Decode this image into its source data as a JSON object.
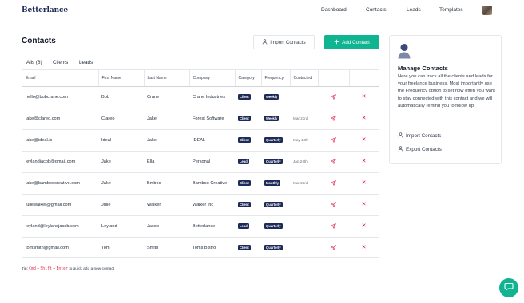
{
  "brand": "Betterlance",
  "nav": {
    "items": [
      {
        "label": "Dashboard"
      },
      {
        "label": "Contacts"
      },
      {
        "label": "Leads"
      },
      {
        "label": "Templates"
      }
    ]
  },
  "page": {
    "title": "Contacts",
    "import_label": "Import Contacts",
    "add_label": "Add Contact"
  },
  "tabs": [
    {
      "label": "Alls (8)",
      "active": true
    },
    {
      "label": "Clients"
    },
    {
      "label": "Leads"
    }
  ],
  "table": {
    "columns": [
      "Email",
      "First Name",
      "Last Name",
      "Company",
      "Category",
      "Frequency",
      "Contacted"
    ],
    "rows": [
      {
        "email": "hello@bobcrane.com",
        "first": "Bob",
        "last": "Crane",
        "company": "Crane Industries",
        "category": "Client",
        "frequency": "Weekly",
        "contacted": ""
      },
      {
        "email": "jake@clareo.com",
        "first": "Clareo",
        "last": "Jake",
        "company": "Forest Software",
        "category": "Client",
        "frequency": "Weekly",
        "contacted": "Mar 23rd"
      },
      {
        "email": "jake@ideal.is",
        "first": "Ideal",
        "last": "Jake",
        "company": "IDEAL",
        "category": "Client",
        "frequency": "Quarterly",
        "contacted": "May 18th"
      },
      {
        "email": "leylandjacob@gmail.com",
        "first": "Jake",
        "last": "Ella",
        "company": "Personal",
        "category": "Lead",
        "frequency": "Quarterly",
        "contacted": "Jan 24th"
      },
      {
        "email": "jake@bamboocreative.com",
        "first": "Jake",
        "last": "Bmboo",
        "company": "Bamboo Creative",
        "category": "Client",
        "frequency": "Monthly",
        "contacted": "Mar 23rd"
      },
      {
        "email": "juliewalker@gmail.com",
        "first": "Julie",
        "last": "Walker",
        "company": "Walker Inc",
        "category": "Client",
        "frequency": "Quarterly",
        "contacted": ""
      },
      {
        "email": "leyland@leylandjacob.com",
        "first": "Leyland",
        "last": "Jacob",
        "company": "Betterlance",
        "category": "Lead",
        "frequency": "Quarterly",
        "contacted": ""
      },
      {
        "email": "tomsmith@gmail.com",
        "first": "Tom",
        "last": "Smith",
        "company": "Toms Bistro",
        "category": "Client",
        "frequency": "Quarterly",
        "contacted": ""
      }
    ]
  },
  "tip": {
    "prefix": "Tip:",
    "key1": "Cmd",
    "plus1": "+",
    "key2": "Shift",
    "plus2": "+",
    "key3": "Enter",
    "suffix": "to quick add a new contact"
  },
  "card": {
    "title": "Manage Contacts",
    "description": "Here you can track all the clients and leads for your freelance business. Most importantly use the Frequency option to set how often you want to stay connected with this contact and we will automatically remind you to follow up.",
    "import_label": "Import Contacts",
    "export_label": "Export Contacts"
  },
  "colors": {
    "accent": "#10b491",
    "brand": "#1e2b58",
    "delete": "#e11d48"
  },
  "icons": {
    "import": "person-upload-icon",
    "add": "plus-icon",
    "send": "paper-plane-icon",
    "delete": "close-icon",
    "card": "user-icon",
    "chat": "chat-icon"
  }
}
